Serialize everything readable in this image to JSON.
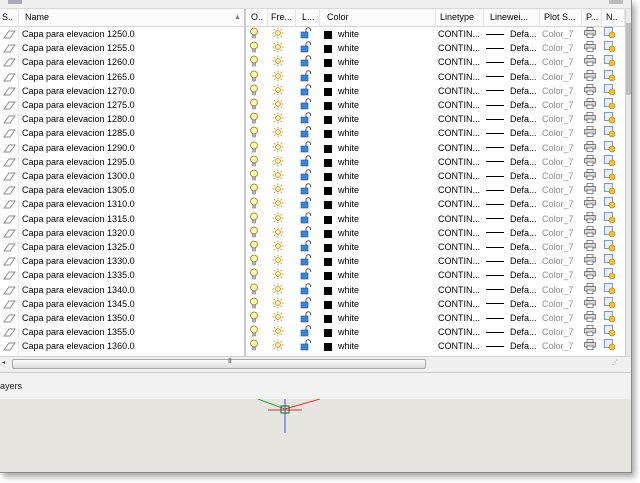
{
  "columns": {
    "status": "S..",
    "name": "Name",
    "on": "O..",
    "freeze": "Fre...",
    "lock": "L...",
    "color": "Color",
    "linetype": "Linetype",
    "lineweight": "Linewei...",
    "plotstyle": "Plot S...",
    "plot": "P...",
    "newvp": "N.."
  },
  "layers": [
    {
      "name": "Capa para elevacion 1250.0",
      "color": "white",
      "linetype": "CONTIN...",
      "lineweight": "Defa...",
      "plotstyle": "Color_7"
    },
    {
      "name": "Capa para elevacion 1255.0",
      "color": "white",
      "linetype": "CONTIN...",
      "lineweight": "Defa...",
      "plotstyle": "Color_7"
    },
    {
      "name": "Capa para elevacion 1260.0",
      "color": "white",
      "linetype": "CONTIN...",
      "lineweight": "Defa...",
      "plotstyle": "Color_7"
    },
    {
      "name": "Capa para elevacion 1265.0",
      "color": "white",
      "linetype": "CONTIN...",
      "lineweight": "Defa...",
      "plotstyle": "Color_7"
    },
    {
      "name": "Capa para elevacion 1270.0",
      "color": "white",
      "linetype": "CONTIN...",
      "lineweight": "Defa...",
      "plotstyle": "Color_7"
    },
    {
      "name": "Capa para elevacion 1275.0",
      "color": "white",
      "linetype": "CONTIN...",
      "lineweight": "Defa...",
      "plotstyle": "Color_7"
    },
    {
      "name": "Capa para elevacion 1280.0",
      "color": "white",
      "linetype": "CONTIN...",
      "lineweight": "Defa...",
      "plotstyle": "Color_7"
    },
    {
      "name": "Capa para elevacion 1285.0",
      "color": "white",
      "linetype": "CONTIN...",
      "lineweight": "Defa...",
      "plotstyle": "Color_7"
    },
    {
      "name": "Capa para elevacion 1290.0",
      "color": "white",
      "linetype": "CONTIN...",
      "lineweight": "Defa...",
      "plotstyle": "Color_7"
    },
    {
      "name": "Capa para elevacion 1295.0",
      "color": "white",
      "linetype": "CONTIN...",
      "lineweight": "Defa...",
      "plotstyle": "Color_7"
    },
    {
      "name": "Capa para elevacion 1300.0",
      "color": "white",
      "linetype": "CONTIN...",
      "lineweight": "Defa...",
      "plotstyle": "Color_7"
    },
    {
      "name": "Capa para elevacion 1305.0",
      "color": "white",
      "linetype": "CONTIN...",
      "lineweight": "Defa...",
      "plotstyle": "Color_7"
    },
    {
      "name": "Capa para elevacion 1310.0",
      "color": "white",
      "linetype": "CONTIN...",
      "lineweight": "Defa...",
      "plotstyle": "Color_7"
    },
    {
      "name": "Capa para elevacion 1315.0",
      "color": "white",
      "linetype": "CONTIN...",
      "lineweight": "Defa...",
      "plotstyle": "Color_7"
    },
    {
      "name": "Capa para elevacion 1320.0",
      "color": "white",
      "linetype": "CONTIN...",
      "lineweight": "Defa...",
      "plotstyle": "Color_7"
    },
    {
      "name": "Capa para elevacion 1325.0",
      "color": "white",
      "linetype": "CONTIN...",
      "lineweight": "Defa...",
      "plotstyle": "Color_7"
    },
    {
      "name": "Capa para elevacion 1330.0",
      "color": "white",
      "linetype": "CONTIN...",
      "lineweight": "Defa...",
      "plotstyle": "Color_7"
    },
    {
      "name": "Capa para elevacion 1335.0",
      "color": "white",
      "linetype": "CONTIN...",
      "lineweight": "Defa...",
      "plotstyle": "Color_7"
    },
    {
      "name": "Capa para elevacion 1340.0",
      "color": "white",
      "linetype": "CONTIN...",
      "lineweight": "Defa...",
      "plotstyle": "Color_7"
    },
    {
      "name": "Capa para elevacion 1345.0",
      "color": "white",
      "linetype": "CONTIN...",
      "lineweight": "Defa...",
      "plotstyle": "Color_7"
    },
    {
      "name": "Capa para elevacion 1350.0",
      "color": "white",
      "linetype": "CONTIN...",
      "lineweight": "Defa...",
      "plotstyle": "Color_7"
    },
    {
      "name": "Capa para elevacion 1355.0",
      "color": "white",
      "linetype": "CONTIN...",
      "lineweight": "Defa...",
      "plotstyle": "Color_7"
    },
    {
      "name": "Capa para elevacion 1360.0",
      "color": "white",
      "linetype": "CONTIN...",
      "lineweight": "Defa...",
      "plotstyle": "Color_7"
    }
  ],
  "hscroll": {
    "grip": "III"
  },
  "status_bar": {
    "label": "ayers"
  },
  "icons": {
    "status": "layer-status-icon",
    "on": "lightbulb-icon",
    "freeze": "sun-icon",
    "lock": "unlock-icon",
    "plot": "printer-icon",
    "newvp": "new-viewport-freeze-icon"
  },
  "colors": {
    "layer_color": "#000000",
    "bulb": "#e8d22a",
    "sun": "#d6a316",
    "lock": "#2f7fd0",
    "plot_style_text": "#8d8d8d"
  }
}
